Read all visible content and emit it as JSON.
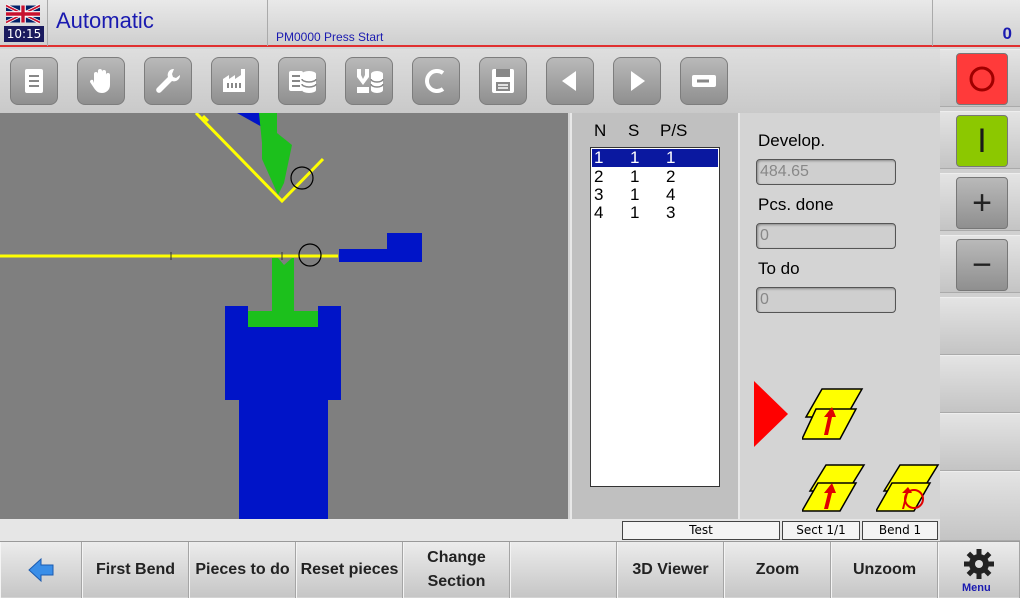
{
  "header": {
    "time": "10:15",
    "mode": "Automatic",
    "status_message": "PM0000 Press Start",
    "counter": "0"
  },
  "toolbar": {
    "icons": [
      "document-icon",
      "hand-icon",
      "wrench-icon",
      "factory-icon",
      "database-list-icon",
      "tool-database-icon",
      "c-icon",
      "save-icon",
      "arrow-left-icon",
      "arrow-right-icon",
      "minus-box-icon"
    ]
  },
  "bend_table": {
    "headers": [
      "N",
      "S",
      "P/S"
    ],
    "rows": [
      {
        "n": "1",
        "s": "1",
        "ps": "1",
        "selected": true
      },
      {
        "n": "2",
        "s": "1",
        "ps": "2",
        "selected": false
      },
      {
        "n": "3",
        "s": "1",
        "ps": "4",
        "selected": false
      },
      {
        "n": "4",
        "s": "1",
        "ps": "3",
        "selected": false
      }
    ]
  },
  "info": {
    "develop_label": "Develop.",
    "develop_value": "484.65",
    "pcs_done_label": "Pcs. done",
    "pcs_done_value": "0",
    "to_do_label": "To do",
    "to_do_value": "0"
  },
  "side": {
    "stop_icon": "stop-circle-icon",
    "start_label": "I",
    "plus_label": "+",
    "minus_label": "−"
  },
  "strip": {
    "program": "Test",
    "section": "Sect  1/1",
    "bend": "Bend 1"
  },
  "footer": {
    "back_icon": "back-arrow-icon",
    "first_bend": "First Bend",
    "pieces_to_do": "Pieces to do",
    "reset_pieces": "Reset pieces",
    "change_section_1": "Change",
    "change_section_2": "Section",
    "viewer_3d": "3D Viewer",
    "zoom": "Zoom",
    "unzoom": "Unzoom",
    "menu": "Menu"
  },
  "colors": {
    "accent_blue": "#1a1ab0",
    "tool_blue": "#0014c8",
    "tool_green": "#1cc01c",
    "sheet_yellow": "#ffff00",
    "stop_red": "#ff3a3a",
    "start_green": "#8cc800"
  }
}
